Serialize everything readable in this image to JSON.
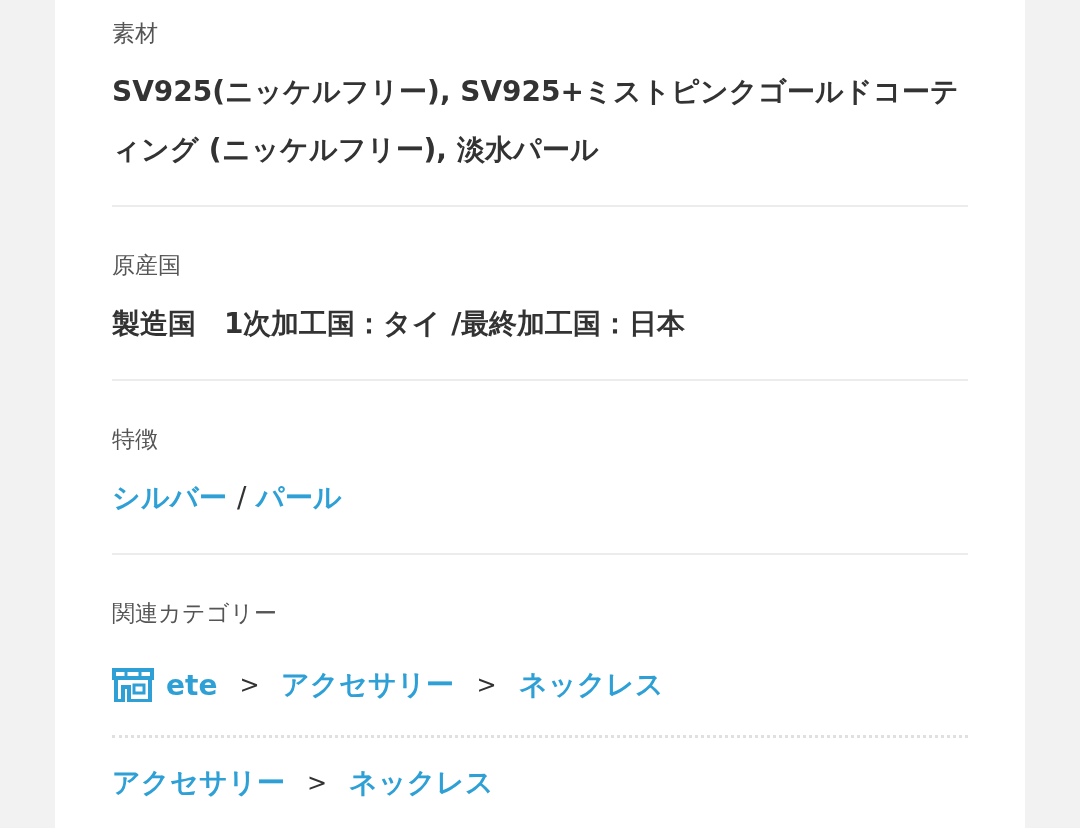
{
  "sections": [
    {
      "label": "素材",
      "kind": "text",
      "value": "SV925(ニッケルフリー), SV925+ミストピンクゴールドコーティング (ニッケルフリー), 淡水パール"
    },
    {
      "label": "原産国",
      "kind": "text",
      "value": "製造国　1次加工国：タイ /最終加工国：日本"
    },
    {
      "label": "特徴",
      "kind": "links",
      "separator": "/",
      "links": [
        "シルバー",
        "パール"
      ]
    },
    {
      "label": "関連カテゴリー",
      "kind": "breadcrumbs",
      "paths": [
        {
          "kind": "shop",
          "separator": ">",
          "items": [
            "ete",
            "アクセサリー",
            "ネックレス"
          ]
        },
        {
          "kind": "category",
          "separator": ">",
          "items": [
            "アクセサリー",
            "ネックレス"
          ]
        }
      ]
    }
  ]
}
